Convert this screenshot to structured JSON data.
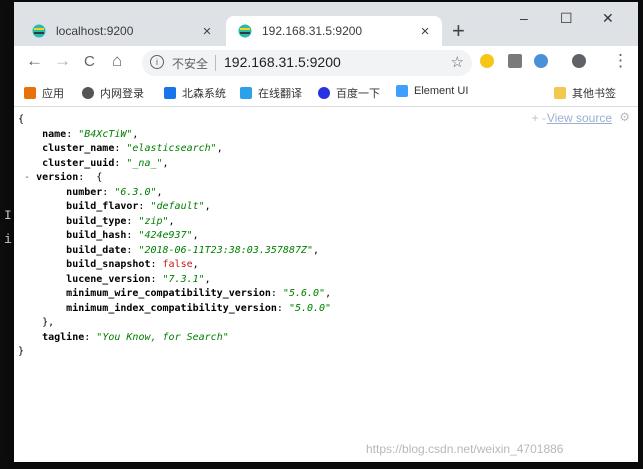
{
  "tabs": [
    {
      "label": "localhost:9200",
      "close": "×"
    },
    {
      "label": "192.168.31.5:9200",
      "close": "×"
    }
  ],
  "new_tab": "+",
  "window_controls": {
    "minimize": "–",
    "maximize": "☐",
    "close": "✕"
  },
  "toolbar": {
    "back": "←",
    "forward": "→",
    "reload": "C",
    "home": "⌂",
    "security_label": "不安全",
    "url": "192.168.31.5:9200",
    "menu": "⋮"
  },
  "bookmarks": [
    {
      "label": "应用",
      "icon": "apps-grid-icon",
      "color": "#e8710a"
    },
    {
      "label": "内网登录",
      "icon": "globe-icon",
      "color": "#555555"
    },
    {
      "label": "北森系统",
      "icon": "bookmark-b-icon",
      "color": "#1a73e8"
    },
    {
      "label": "在线翻译",
      "icon": "translate-d-icon",
      "color": "#2aa1e8"
    },
    {
      "label": "百度一下",
      "icon": "baidu-paw-icon",
      "color": "#2932e1"
    },
    {
      "label": "Element UI",
      "icon": "element-ui-icon",
      "color": "#409eff"
    },
    {
      "label": "其他书签",
      "icon": "folder-icon",
      "color": "#f2c94c"
    }
  ],
  "json_viewer": {
    "controls": "+ -",
    "view_source": "View source",
    "lines": [
      {
        "indent": 0,
        "toggle": "",
        "key": "",
        "value": "",
        "type": "",
        "text": "{"
      },
      {
        "indent": 1,
        "toggle": "",
        "key": "name",
        "value": "\"B4XcTiW\"",
        "type": "str",
        "text": ","
      },
      {
        "indent": 1,
        "toggle": "",
        "key": "cluster_name",
        "value": "\"elasticsearch\"",
        "type": "str",
        "text": ","
      },
      {
        "indent": 1,
        "toggle": "",
        "key": "cluster_uuid",
        "value": "\"_na_\"",
        "type": "str",
        "text": ","
      },
      {
        "indent": 1,
        "toggle": "-",
        "key": "version",
        "value": "",
        "type": "",
        "text": " {"
      },
      {
        "indent": 2,
        "toggle": "",
        "key": "number",
        "value": "\"6.3.0\"",
        "type": "str",
        "text": ","
      },
      {
        "indent": 2,
        "toggle": "",
        "key": "build_flavor",
        "value": "\"default\"",
        "type": "str",
        "text": ","
      },
      {
        "indent": 2,
        "toggle": "",
        "key": "build_type",
        "value": "\"zip\"",
        "type": "str",
        "text": ","
      },
      {
        "indent": 2,
        "toggle": "",
        "key": "build_hash",
        "value": "\"424e937\"",
        "type": "str",
        "text": ","
      },
      {
        "indent": 2,
        "toggle": "",
        "key": "build_date",
        "value": "\"2018-06-11T23:38:03.357887Z\"",
        "type": "str",
        "text": ","
      },
      {
        "indent": 2,
        "toggle": "",
        "key": "build_snapshot",
        "value": "false",
        "type": "bool",
        "text": ","
      },
      {
        "indent": 2,
        "toggle": "",
        "key": "lucene_version",
        "value": "\"7.3.1\"",
        "type": "str",
        "text": ","
      },
      {
        "indent": 2,
        "toggle": "",
        "key": "minimum_wire_compatibility_version",
        "value": "\"5.6.0\"",
        "type": "str",
        "text": ","
      },
      {
        "indent": 2,
        "toggle": "",
        "key": "minimum_index_compatibility_version",
        "value": "\"5.0.0\"",
        "type": "str",
        "text": ""
      },
      {
        "indent": 1,
        "toggle": "",
        "key": "",
        "value": "",
        "type": "",
        "text": "},"
      },
      {
        "indent": 1,
        "toggle": "",
        "key": "tagline",
        "value": "\"You Know, for Search\"",
        "type": "str",
        "text": ""
      },
      {
        "indent": 0,
        "toggle": "",
        "key": "",
        "value": "",
        "type": "",
        "text": "}"
      }
    ]
  },
  "watermark": "https://blog.csdn.net/weixin_4701886",
  "colors": {
    "tabstrip": "#dee1e6",
    "string": "#008000",
    "boolean": "#c41a16",
    "link": "#9ab0d0"
  }
}
